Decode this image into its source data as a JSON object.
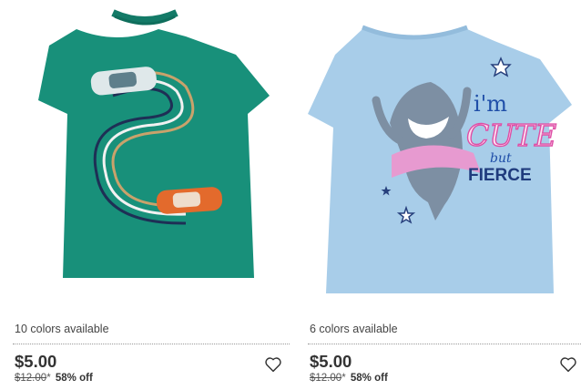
{
  "products": [
    {
      "image_alt": "",
      "colors_available": "10 colors available",
      "price": "$5.00",
      "original_price": "$12.00",
      "asterisk": "*",
      "discount": "58% off",
      "favorite_icon": "heart-outline-icon",
      "shirt_color": "#18907a"
    },
    {
      "image_alt": "",
      "colors_available": "6 colors available",
      "price": "$5.00",
      "original_price": "$12.00",
      "asterisk": "*",
      "discount": "58% off",
      "favorite_icon": "heart-outline-icon",
      "shirt_color": "#a8cde9",
      "graphic_text": [
        "i'm",
        "CUTE",
        "but",
        "FIERCE"
      ]
    }
  ]
}
